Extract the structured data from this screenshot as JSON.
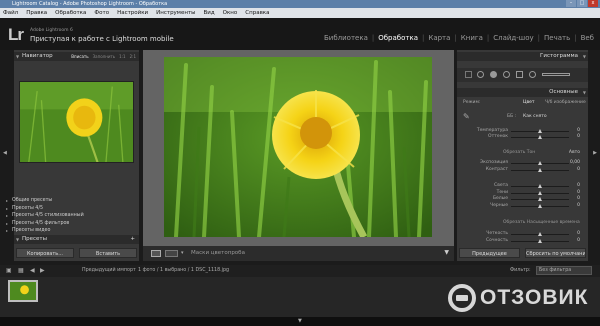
{
  "window": {
    "title": "Lightroom Catalog - Adobe Photoshop Lightroom - Обработка",
    "minimize": "–",
    "maximize": "□",
    "close": "x"
  },
  "menu": [
    "Файл",
    "Правка",
    "Обработка",
    "Фото",
    "Настройки",
    "Инструменты",
    "Вид",
    "Окно",
    "Справка"
  ],
  "identity": {
    "logo": "Lr",
    "line1": "Adobe Lightroom 6",
    "line2": "Приступая к работе с Lightroom mobile"
  },
  "modules": [
    {
      "label": "Библиотека",
      "active": false
    },
    {
      "label": "Обработка",
      "active": true
    },
    {
      "label": "Карта",
      "active": false
    },
    {
      "label": "Книга",
      "active": false
    },
    {
      "label": "Слайд-шоу",
      "active": false
    },
    {
      "label": "Печать",
      "active": false
    },
    {
      "label": "Веб",
      "active": false
    }
  ],
  "left": {
    "navigator": {
      "title": "Навигатор",
      "options": [
        "Вписать",
        "Заполнить",
        "1:1",
        "2:1"
      ],
      "selected": "Вписать"
    },
    "presets": {
      "title": "Пресеты",
      "add": "+",
      "items": [
        "Общие пресеты",
        "Пресеты 4/5",
        "Пресеты 4/5 стилизованный",
        "Пресеты 4/5 фильтров",
        "Пресеты видео"
      ]
    },
    "copy_button": "Копировать...",
    "paste_button": "Вставить"
  },
  "center": {
    "toolbar_label": "Маски цветопроба",
    "collapse": "▼"
  },
  "right": {
    "histogram_title": "Гистограмма",
    "basic_title": "Основные",
    "treatment": {
      "label": "Режим:",
      "color": "Цвет",
      "bw": "Ч/б изображение"
    },
    "wb": {
      "label": "ББ :",
      "value": "Как снято"
    },
    "rows": [
      {
        "label": "Температура",
        "value": "0",
        "pos": 0.5
      },
      {
        "label": "Оттенок",
        "value": "0",
        "pos": 0.5
      },
      {
        "label": "Обрезать Тон",
        "value": "Авто",
        "pos": null
      },
      {
        "label": "Экспозиция",
        "value": "0,00",
        "pos": 0.5
      },
      {
        "label": "Контраст",
        "value": "0",
        "pos": 0.5
      },
      {
        "label": "Света",
        "value": "0",
        "pos": 0.5
      },
      {
        "label": "Тени",
        "value": "0",
        "pos": 0.5
      },
      {
        "label": "Белые",
        "value": "0",
        "pos": 0.5
      },
      {
        "label": "Черные",
        "value": "0",
        "pos": 0.5
      },
      {
        "label": "Обрезать Насыщенные времена",
        "value": "",
        "pos": null
      },
      {
        "label": "Четкость",
        "value": "0",
        "pos": 0.5
      },
      {
        "label": "Сочность",
        "value": "0",
        "pos": 0.5
      }
    ],
    "previous_button": "Предыдущее",
    "reset_button": "Сбросить по умолчанию"
  },
  "filmstrip": {
    "previous_import": "Предыдущий импорт",
    "count": "1 фото / 1 выбрано / 1 DSC_1118.jpg",
    "filter_label": "Фильтр:",
    "filter_value": "Без фильтра"
  },
  "watermark": "ОТЗОВИК",
  "colors": {
    "accent": "#5c7fa8",
    "panel": "#383838",
    "background": "#646464"
  }
}
